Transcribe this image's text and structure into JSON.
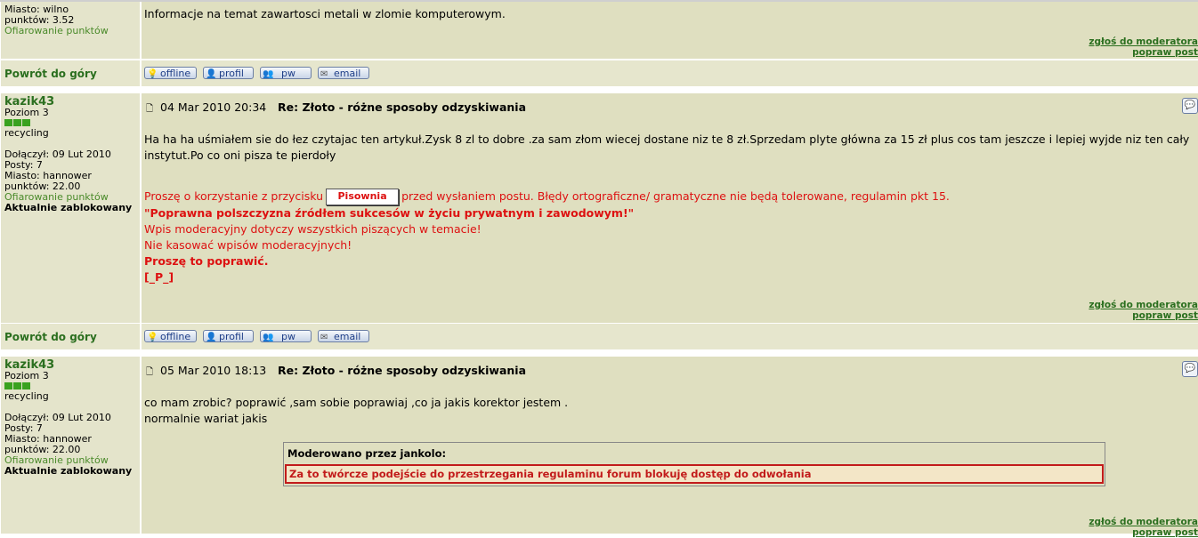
{
  "post0": {
    "city": "Miasto: wilno",
    "points": "punktów: 3.52",
    "offer": "Ofiarowanie punktów",
    "text": "Informacje na temat zawartosci metali w zlomie komputerowym.",
    "report": "zgłoś do moderatora",
    "edit": "popraw post"
  },
  "bar": {
    "back": "Powrót do góry",
    "offline": "offline",
    "profil": "profil",
    "pw": "pw",
    "email": "email"
  },
  "post1": {
    "author": "kazik43",
    "level": "Poziom 3",
    "group": "recycling",
    "joined": "Dołączył: 09 Lut 2010",
    "posts": "Posty: 7",
    "city": "Miasto: hannower",
    "points": "punktów: 22.00",
    "offer": "Ofiarowanie punktów",
    "blocked": "Aktualnie zablokowany",
    "date": "04 Mar 2010 20:34",
    "subject": "Re: Złoto - różne sposoby odzyskiwania",
    "body1": "Ha ha ha uśmiałem sie do łez czytajac ten artykuł.Zysk 8 zl to dobre .za sam złom wiecej dostane niz te 8 zł.Sprzedam plyte główna za 15 zł plus cos tam jeszcze i lepiej wyjde niz ten cały",
    "body2": "instytut.Po co oni pisza te pierdoły",
    "mod_pre": "Proszę o korzystanie z przycisku",
    "pisownia": "Pisownia",
    "mod_post": "przed wysłaniem postu. Błędy ortograficzne/ gramatyczne nie będą tolerowane, regulamin pkt 15.",
    "mod_quote": "\"Poprawna polszczyzna źródłem sukcesów w życiu prywatnym i zawodowym!\"",
    "mod_l3": "Wpis moderacyjny dotyczy wszystkich piszących w temacie!",
    "mod_l4": "Nie kasować wpisów moderacyjnych!",
    "mod_l5": "Proszę to poprawić.",
    "mod_l6": "[_P_]",
    "report": "zgłoś do moderatora",
    "edit": "popraw post"
  },
  "post2": {
    "author": "kazik43",
    "level": "Poziom 3",
    "group": "recycling",
    "joined": "Dołączył: 09 Lut 2010",
    "posts": "Posty: 7",
    "city": "Miasto: hannower",
    "points": "punktów: 22.00",
    "offer": "Ofiarowanie punktów",
    "blocked": "Aktualnie zablokowany",
    "date": "05 Mar 2010 18:13",
    "subject": "Re: Złoto - różne sposoby odzyskiwania",
    "body1": "co mam zrobic? poprawić ,sam sobie poprawiaj ,co ja jakis korektor jestem .",
    "body2": "normalnie wariat jakis",
    "mod_header": "Moderowano przez jankolo:",
    "mod_text": "Za to twórcze podejście do przestrzegania regulaminu forum blokuję dostęp do odwołania",
    "report": "zgłoś do moderatora",
    "edit": "popraw post"
  }
}
